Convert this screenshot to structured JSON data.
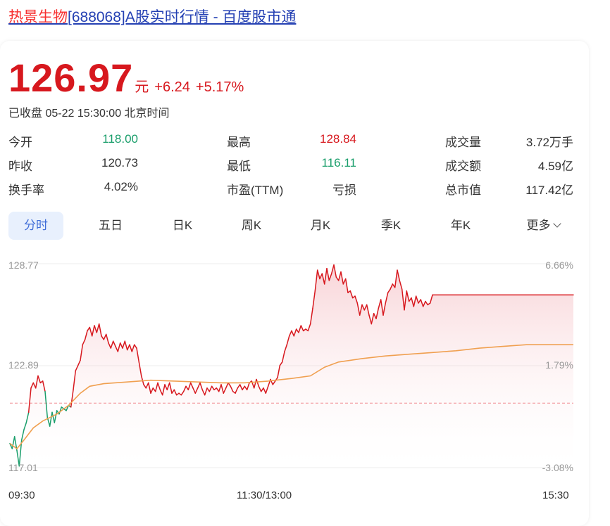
{
  "page": {
    "title_highlight": "热景生物",
    "title_rest": "[688068]A股实时行情 - 百度股市通"
  },
  "quote": {
    "price": "126.97",
    "unit": "元",
    "change": "+6.24",
    "change_pct": "+5.17%",
    "status": "已收盘 05-22 15:30:00 北京时间"
  },
  "stats": [
    {
      "label": "今开",
      "value": "118.00",
      "color": "green"
    },
    {
      "label": "最高",
      "value": "128.84",
      "color": "red"
    },
    {
      "label": "成交量",
      "value": "3.72万手",
      "color": "none"
    },
    {
      "label": "昨收",
      "value": "120.73",
      "color": "none"
    },
    {
      "label": "最低",
      "value": "116.11",
      "color": "green"
    },
    {
      "label": "成交额",
      "value": "4.59亿",
      "color": "none"
    },
    {
      "label": "换手率",
      "value": "4.02%",
      "color": "none"
    },
    {
      "label": "市盈(TTM)",
      "value": "亏损",
      "color": "none"
    },
    {
      "label": "总市值",
      "value": "117.42亿",
      "color": "none"
    }
  ],
  "tabs": [
    "分时",
    "五日",
    "日K",
    "周K",
    "月K",
    "季K",
    "年K",
    "更多"
  ],
  "colors": {
    "up": "#d7181e",
    "down": "#1a9e6b",
    "avg_line": "#f0a050",
    "accent": "#3f6dd8"
  },
  "chart_data": {
    "type": "line",
    "y_left_ticks": [
      "128.77",
      "122.89",
      "117.01"
    ],
    "y_right_ticks": [
      "6.66%",
      "1.79%",
      "-3.08%"
    ],
    "x_ticks": [
      "09:30",
      "11:30/13:00",
      "15:30"
    ],
    "prev_close": 120.73,
    "ylim": [
      117.01,
      128.77
    ],
    "session_minutes": 240,
    "price": [
      [
        0,
        118.4
      ],
      [
        1,
        118.1
      ],
      [
        2,
        118.8
      ],
      [
        3,
        118.0
      ],
      [
        4,
        117.1
      ],
      [
        5,
        118.6
      ],
      [
        6,
        119.2
      ],
      [
        7,
        119.6
      ],
      [
        8,
        120.2
      ],
      [
        9,
        121.6
      ],
      [
        10,
        121.9
      ],
      [
        11,
        121.6
      ],
      [
        12,
        122.3
      ],
      [
        13,
        121.9
      ],
      [
        14,
        122.0
      ],
      [
        15,
        121.4
      ],
      [
        16,
        119.9
      ],
      [
        17,
        119.4
      ],
      [
        18,
        120.2
      ],
      [
        19,
        119.6
      ],
      [
        20,
        120.3
      ],
      [
        21,
        120.1
      ],
      [
        22,
        120.5
      ],
      [
        23,
        120.4
      ],
      [
        24,
        120.3
      ],
      [
        25,
        120.6
      ],
      [
        26,
        120.5
      ],
      [
        27,
        121.5
      ],
      [
        28,
        122.6
      ],
      [
        29,
        122.9
      ],
      [
        30,
        123.2
      ],
      [
        31,
        124.1
      ],
      [
        32,
        124.4
      ],
      [
        33,
        124.9
      ],
      [
        34,
        125.1
      ],
      [
        35,
        124.6
      ],
      [
        36,
        125.2
      ],
      [
        37,
        124.8
      ],
      [
        38,
        125.3
      ],
      [
        39,
        124.6
      ],
      [
        40,
        124.4
      ],
      [
        41,
        124.7
      ],
      [
        42,
        124.2
      ],
      [
        43,
        123.9
      ],
      [
        44,
        124.3
      ],
      [
        45,
        124.0
      ],
      [
        46,
        123.7
      ],
      [
        47,
        124.2
      ],
      [
        48,
        123.9
      ],
      [
        49,
        124.3
      ],
      [
        50,
        123.8
      ],
      [
        51,
        124.1
      ],
      [
        52,
        123.7
      ],
      [
        53,
        124.1
      ],
      [
        54,
        123.9
      ],
      [
        55,
        123.1
      ],
      [
        56,
        122.3
      ],
      [
        57,
        121.8
      ],
      [
        58,
        121.6
      ],
      [
        59,
        121.9
      ],
      [
        60,
        121.3
      ],
      [
        61,
        121.6
      ],
      [
        62,
        121.4
      ],
      [
        63,
        121.9
      ],
      [
        64,
        121.5
      ],
      [
        65,
        121.2
      ],
      [
        66,
        121.8
      ],
      [
        67,
        121.5
      ],
      [
        68,
        121.9
      ],
      [
        69,
        121.3
      ],
      [
        70,
        121.5
      ],
      [
        71,
        121.2
      ],
      [
        72,
        121.3
      ],
      [
        73,
        121.2
      ],
      [
        74,
        121.4
      ],
      [
        75,
        121.7
      ],
      [
        76,
        121.5
      ],
      [
        77,
        121.9
      ],
      [
        78,
        121.6
      ],
      [
        79,
        121.3
      ],
      [
        80,
        121.6
      ],
      [
        81,
        121.9
      ],
      [
        82,
        121.5
      ],
      [
        83,
        121.2
      ],
      [
        84,
        121.6
      ],
      [
        85,
        121.4
      ],
      [
        86,
        121.7
      ],
      [
        87,
        121.5
      ],
      [
        88,
        121.6
      ],
      [
        89,
        121.4
      ],
      [
        90,
        121.8
      ],
      [
        91,
        121.3
      ],
      [
        92,
        121.6
      ],
      [
        93,
        121.9
      ],
      [
        94,
        121.7
      ],
      [
        95,
        121.4
      ],
      [
        96,
        121.3
      ],
      [
        97,
        121.6
      ],
      [
        98,
        121.8
      ],
      [
        99,
        121.5
      ],
      [
        100,
        121.7
      ],
      [
        101,
        121.5
      ],
      [
        102,
        121.9
      ],
      [
        103,
        122.0
      ],
      [
        104,
        121.6
      ],
      [
        105,
        122.1
      ],
      [
        106,
        121.7
      ],
      [
        107,
        121.4
      ],
      [
        108,
        121.6
      ],
      [
        109,
        121.3
      ],
      [
        110,
        121.7
      ],
      [
        111,
        122.1
      ],
      [
        112,
        121.8
      ],
      [
        113,
        122.0
      ],
      [
        114,
        122.2
      ],
      [
        115,
        122.9
      ],
      [
        116,
        123.1
      ],
      [
        117,
        123.7
      ],
      [
        118,
        124.1
      ],
      [
        119,
        124.6
      ],
      [
        120,
        124.9
      ],
      [
        121,
        124.6
      ],
      [
        122,
        125.0
      ],
      [
        123,
        124.8
      ],
      [
        124,
        125.2
      ],
      [
        125,
        124.9
      ],
      [
        126,
        125.0
      ],
      [
        127,
        124.9
      ],
      [
        128,
        125.3
      ],
      [
        129,
        126.2
      ],
      [
        130,
        127.2
      ],
      [
        131,
        128.4
      ],
      [
        132,
        127.9
      ],
      [
        133,
        128.2
      ],
      [
        134,
        127.6
      ],
      [
        135,
        128.5
      ],
      [
        136,
        127.8
      ],
      [
        137,
        128.2
      ],
      [
        138,
        128.7
      ],
      [
        139,
        128.0
      ],
      [
        140,
        127.8
      ],
      [
        141,
        128.3
      ],
      [
        142,
        127.6
      ],
      [
        143,
        127.9
      ],
      [
        144,
        127.1
      ],
      [
        145,
        127.2
      ],
      [
        146,
        126.8
      ],
      [
        147,
        126.9
      ],
      [
        148,
        126.5
      ],
      [
        149,
        125.8
      ],
      [
        150,
        126.4
      ],
      [
        151,
        126.1
      ],
      [
        152,
        126.4
      ],
      [
        153,
        125.8
      ],
      [
        154,
        125.3
      ],
      [
        155,
        125.9
      ],
      [
        156,
        125.6
      ],
      [
        157,
        126.2
      ],
      [
        158,
        126.7
      ],
      [
        159,
        125.8
      ],
      [
        160,
        126.5
      ],
      [
        161,
        127.1
      ],
      [
        162,
        127.3
      ],
      [
        163,
        127.6
      ],
      [
        164,
        127.4
      ],
      [
        165,
        128.4
      ],
      [
        166,
        127.8
      ],
      [
        167,
        127.3
      ],
      [
        168,
        126.1
      ],
      [
        169,
        127.2
      ],
      [
        170,
        126.6
      ],
      [
        171,
        126.8
      ],
      [
        172,
        126.3
      ],
      [
        173,
        126.9
      ],
      [
        174,
        126.5
      ],
      [
        175,
        126.7
      ],
      [
        176,
        126.3
      ],
      [
        177,
        126.6
      ],
      [
        178,
        126.4
      ],
      [
        179,
        126.5
      ],
      [
        180,
        126.97
      ],
      [
        240,
        126.97
      ]
    ],
    "average": [
      [
        0,
        118.4
      ],
      [
        3,
        118.1
      ],
      [
        6,
        118.6
      ],
      [
        10,
        119.3
      ],
      [
        14,
        119.7
      ],
      [
        20,
        120.1
      ],
      [
        25,
        120.6
      ],
      [
        30,
        121.3
      ],
      [
        34,
        121.7
      ],
      [
        40,
        121.85
      ],
      [
        50,
        121.95
      ],
      [
        60,
        122.05
      ],
      [
        70,
        122.0
      ],
      [
        80,
        121.95
      ],
      [
        90,
        121.9
      ],
      [
        100,
        121.9
      ],
      [
        110,
        122.0
      ],
      [
        120,
        122.15
      ],
      [
        128,
        122.3
      ],
      [
        134,
        122.8
      ],
      [
        140,
        123.1
      ],
      [
        150,
        123.3
      ],
      [
        160,
        123.45
      ],
      [
        170,
        123.55
      ],
      [
        180,
        123.65
      ],
      [
        190,
        123.75
      ],
      [
        200,
        123.9
      ],
      [
        210,
        124.0
      ],
      [
        220,
        124.1
      ],
      [
        240,
        124.1
      ]
    ]
  }
}
